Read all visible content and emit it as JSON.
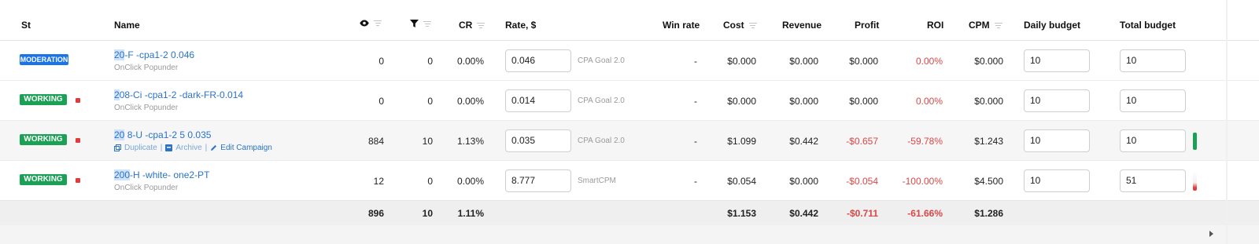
{
  "columns": {
    "st": "St",
    "name": "Name",
    "impressions_icon": "eye-icon",
    "conversions_icon": "funnel-icon",
    "cr": "CR",
    "rate": "Rate, $",
    "win_rate": "Win rate",
    "cost": "Cost",
    "revenue": "Revenue",
    "profit": "Profit",
    "roi": "ROI",
    "cpm": "CPM",
    "daily_budget": "Daily budget",
    "total_budget": "Total budget"
  },
  "rows": [
    {
      "status": "MODERATION",
      "name_hl": "20",
      "name": "-F -cpa1-2 0.046",
      "sub": "OnClick Popunder",
      "impressions": "0",
      "conversions": "0",
      "cr": "0.00%",
      "rate": "0.046",
      "goal": "CPA Goal 2.0",
      "win_rate": "-",
      "cost": "$0.000",
      "revenue": "$0.000",
      "profit": "$0.000",
      "roi": "0.00%",
      "cpm": "$0.000",
      "daily_budget": "10",
      "total_budget": "10"
    },
    {
      "status": "WORKING",
      "name_hl": "2",
      "name": "08-Ci -cpa1-2 -dark-FR-0.014",
      "sub": "OnClick Popunder",
      "impressions": "0",
      "conversions": "0",
      "cr": "0.00%",
      "rate": "0.014",
      "goal": "CPA Goal 2.0",
      "win_rate": "-",
      "cost": "$0.000",
      "revenue": "$0.000",
      "profit": "$0.000",
      "roi": "0.00%",
      "cpm": "$0.000",
      "daily_budget": "10",
      "total_budget": "10"
    },
    {
      "status": "WORKING",
      "name_hl": "20",
      "name": " 8-U -cpa1-2 5 0.035",
      "actions": {
        "duplicate": "Duplicate",
        "archive": "Archive",
        "edit": "Edit Campaign"
      },
      "impressions": "884",
      "conversions": "10",
      "cr": "1.13%",
      "rate": "0.035",
      "goal": "CPA Goal 2.0",
      "win_rate": "-",
      "cost": "$1.099",
      "revenue": "$0.442",
      "profit": "-$0.657",
      "roi": "-59.78%",
      "cpm": "$1.243",
      "daily_budget": "10",
      "total_budget": "10"
    },
    {
      "status": "WORKING",
      "name_hl": "200",
      "name": "-H -white- one2-PT",
      "sub": "OnClick Popunder",
      "impressions": "12",
      "conversions": "0",
      "cr": "0.00%",
      "rate": "8.777",
      "goal": "SmartCPM",
      "win_rate": "-",
      "cost": "$0.054",
      "revenue": "$0.000",
      "profit": "-$0.054",
      "roi": "-100.00%",
      "cpm": "$4.500",
      "daily_budget": "10",
      "total_budget": "51"
    }
  ],
  "totals": {
    "impressions": "896",
    "conversions": "10",
    "cr": "1.11%",
    "cost": "$1.153",
    "revenue": "$0.442",
    "profit": "-$0.711",
    "roi": "-61.66%",
    "cpm": "$1.286"
  },
  "colors": {
    "moderation": "#1a73e8",
    "working": "#1aa155",
    "negative": "#d94747",
    "link": "#2a73c7"
  }
}
